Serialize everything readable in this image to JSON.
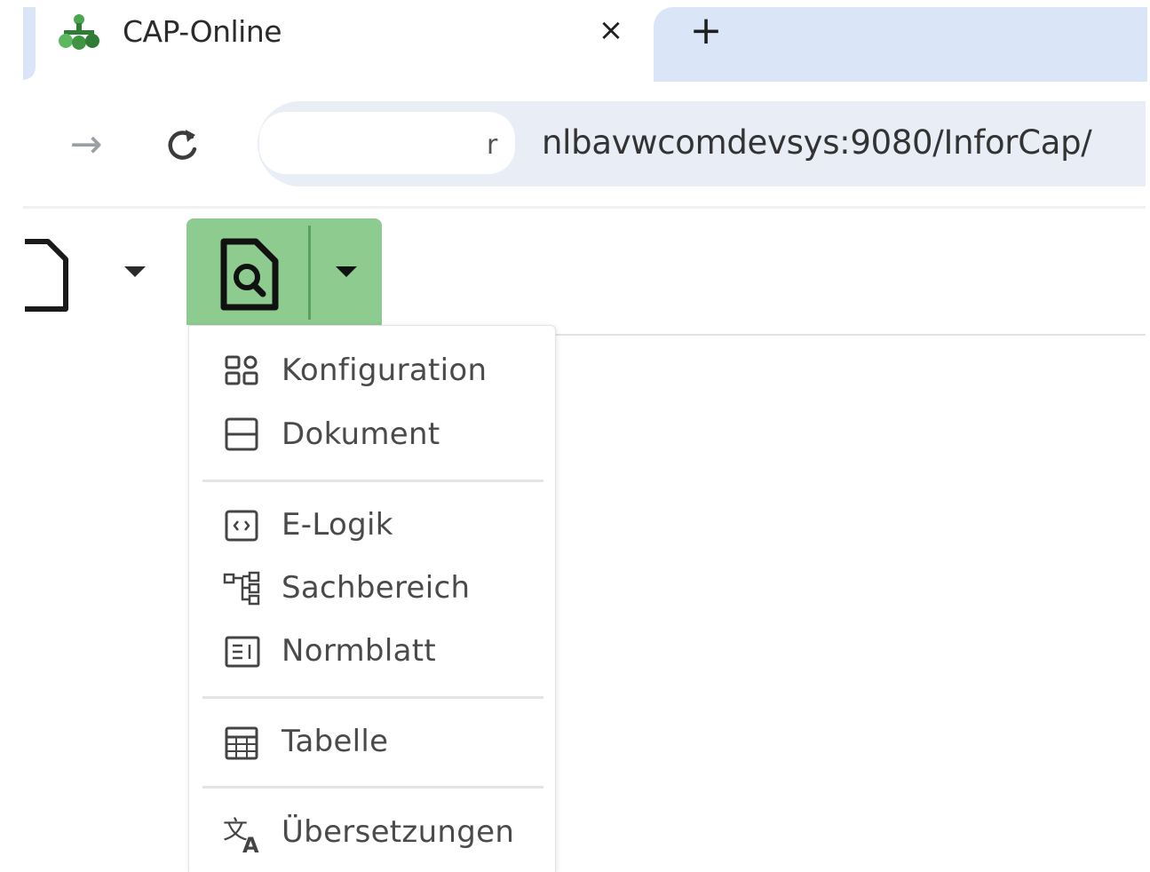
{
  "browser": {
    "tab": {
      "title": "CAP-Online",
      "favicon": "cap-logo-icon",
      "close_glyph": "×",
      "new_tab_glyph": "+"
    },
    "nav": {
      "forward_glyph": "→",
      "reload_icon": "reload-icon"
    },
    "omnibox": {
      "url": "nlbavwcomdevsys:9080/InforCap/",
      "partial_glyph": "r"
    }
  },
  "app_toolbar": {
    "new_document_icon": "document-icon",
    "preview_icon": "document-search-icon",
    "caret_icon": "caret-down-icon",
    "active_button_color": "#8ecb8f"
  },
  "menu": {
    "groups": [
      {
        "items": [
          {
            "label": "Konfiguration",
            "icon": "grid-shapes-icon"
          },
          {
            "label": "Dokument",
            "icon": "document-split-icon"
          }
        ]
      },
      {
        "items": [
          {
            "label": "E-Logik",
            "icon": "code-box-icon"
          },
          {
            "label": "Sachbereich",
            "icon": "tree-structure-icon"
          },
          {
            "label": "Normblatt",
            "icon": "sheet-lines-icon"
          }
        ]
      },
      {
        "items": [
          {
            "label": "Tabelle",
            "icon": "table-icon"
          }
        ]
      },
      {
        "items": [
          {
            "label": "Übersetzungen",
            "icon": "translate-icon"
          }
        ]
      }
    ]
  }
}
